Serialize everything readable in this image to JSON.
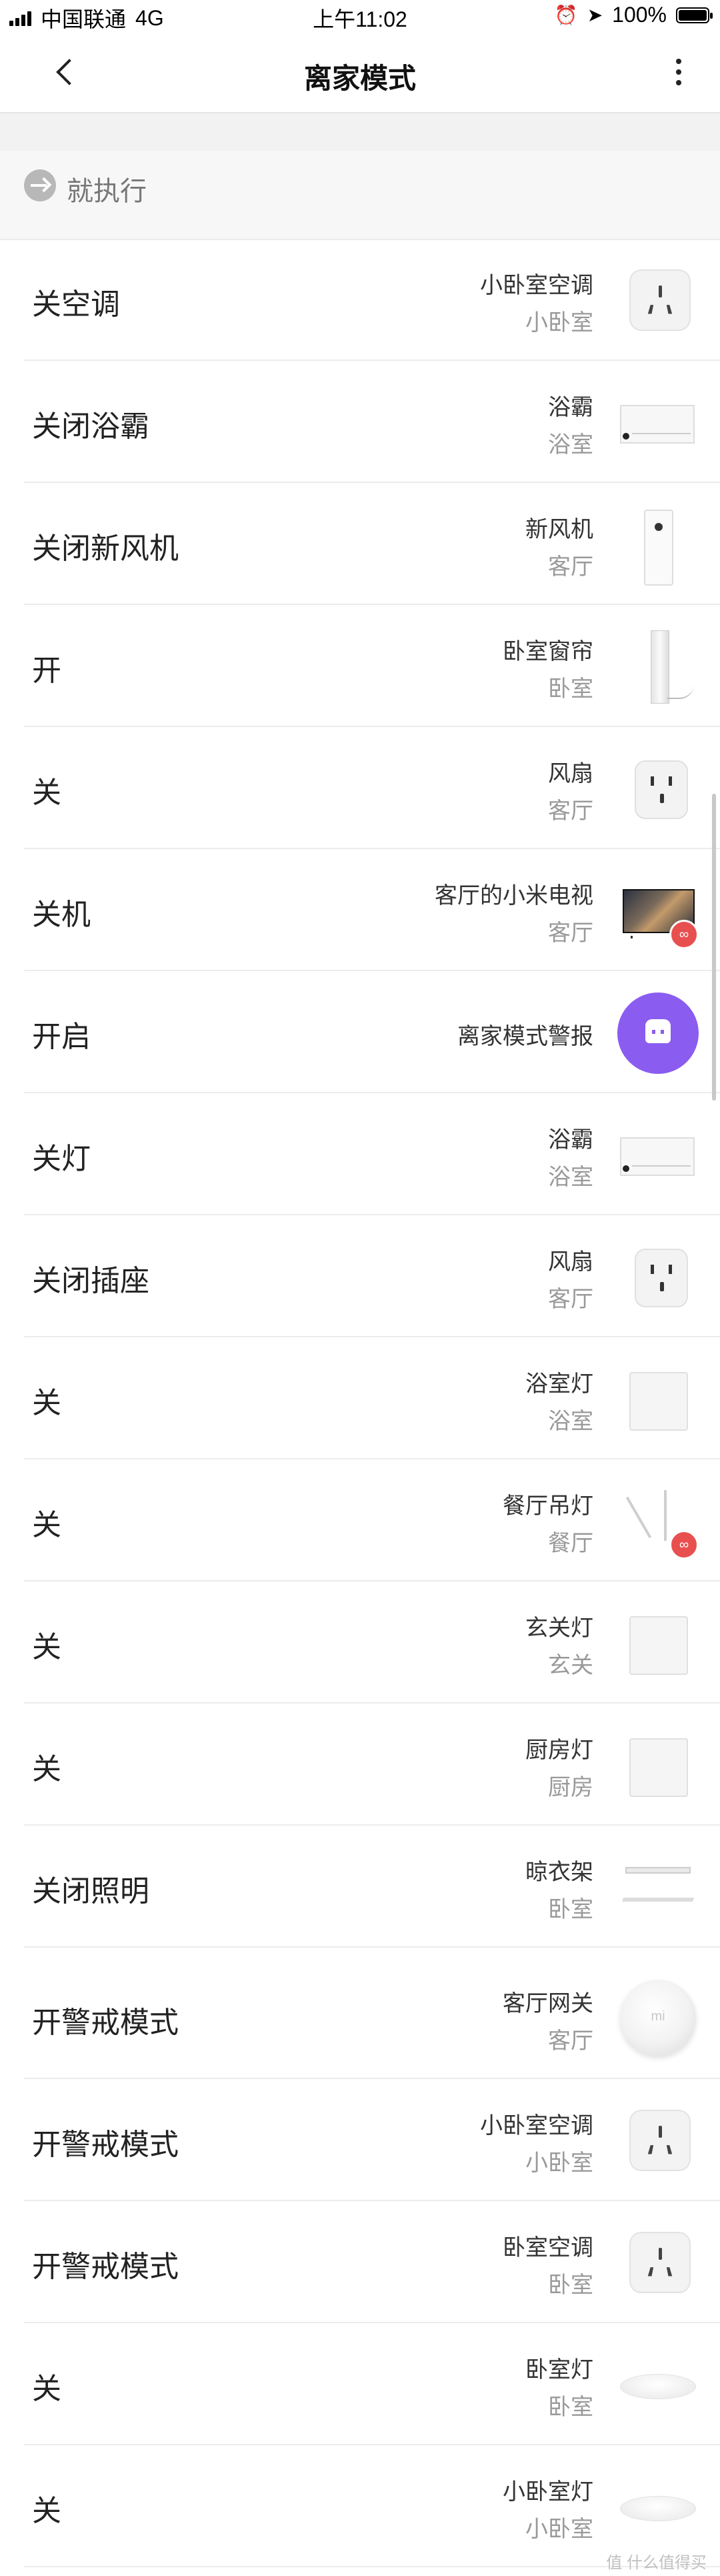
{
  "status_bar": {
    "carrier": "中国联通",
    "network": "4G",
    "time": "上午11:02",
    "battery": "100%"
  },
  "header": {
    "title": "离家模式",
    "back_icon": "chevron-left-icon",
    "more_icon": "more-vertical-icon"
  },
  "execute": {
    "label": "就执行",
    "icon": "arrow-right-circle-icon"
  },
  "actions": [
    {
      "action": "关空调",
      "device": "小卧室空调",
      "room": "小卧室",
      "icon": "ac-partner-icon"
    },
    {
      "action": "关闭浴霸",
      "device": "浴霸",
      "room": "浴室",
      "icon": "bath-heater-icon"
    },
    {
      "action": "关闭新风机",
      "device": "新风机",
      "room": "客厅",
      "icon": "air-purifier-icon"
    },
    {
      "action": "开",
      "device": "卧室窗帘",
      "room": "卧室",
      "icon": "curtain-icon"
    },
    {
      "action": "关",
      "device": "风扇",
      "room": "客厅",
      "icon": "smart-plug-icon"
    },
    {
      "action": "关机",
      "device": "客厅的小米电视",
      "room": "客厅",
      "icon": "tv-icon"
    },
    {
      "action": "开启",
      "device": "离家模式警报",
      "room": "",
      "icon": "alarm-robot-icon"
    },
    {
      "action": "关灯",
      "device": "浴霸",
      "room": "浴室",
      "icon": "bath-heater-icon"
    },
    {
      "action": "关闭插座",
      "device": "风扇",
      "room": "客厅",
      "icon": "smart-plug-icon"
    },
    {
      "action": "关",
      "device": "浴室灯",
      "room": "浴室",
      "icon": "wall-switch-icon"
    },
    {
      "action": "关",
      "device": "餐厅吊灯",
      "room": "餐厅",
      "icon": "pendant-light-icon"
    },
    {
      "action": "关",
      "device": "玄关灯",
      "room": "玄关",
      "icon": "wall-switch-icon"
    },
    {
      "action": "关",
      "device": "厨房灯",
      "room": "厨房",
      "icon": "wall-switch-icon"
    },
    {
      "action": "关闭照明",
      "device": "晾衣架",
      "room": "卧室",
      "icon": "clothes-rack-icon"
    },
    {
      "action": "开警戒模式",
      "device": "客厅网关",
      "room": "客厅",
      "icon": "gateway-icon"
    },
    {
      "action": "开警戒模式",
      "device": "小卧室空调",
      "room": "小卧室",
      "icon": "ac-partner-icon"
    },
    {
      "action": "开警戒模式",
      "device": "卧室空调",
      "room": "卧室",
      "icon": "ac-partner-icon"
    },
    {
      "action": "关",
      "device": "卧室灯",
      "room": "卧室",
      "icon": "ceiling-light-icon"
    },
    {
      "action": "关",
      "device": "小卧室灯",
      "room": "小卧室",
      "icon": "ceiling-light-icon"
    }
  ],
  "watermark": "值 什么值得买"
}
